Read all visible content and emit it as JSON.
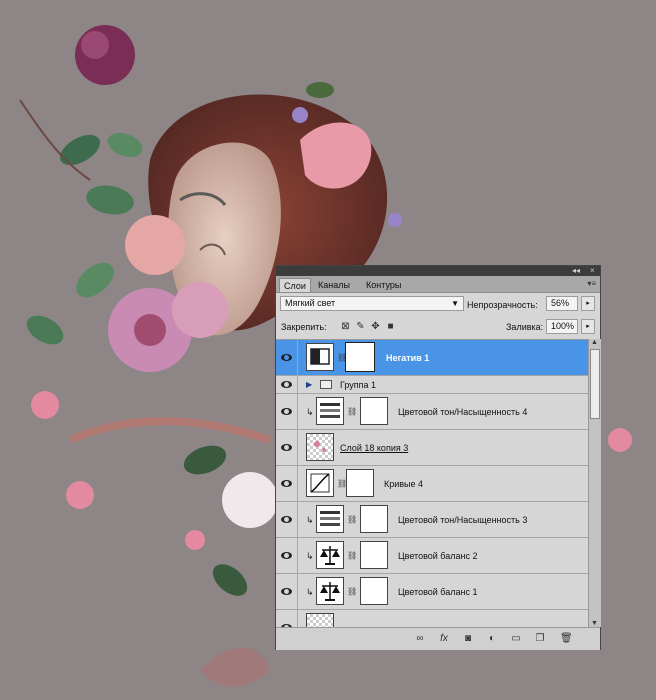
{
  "panel": {
    "topbar": {
      "collapse_glyph": "◂◂",
      "close_glyph": "×"
    },
    "tabs": [
      {
        "label": "Слои",
        "active": true
      },
      {
        "label": "Каналы",
        "active": false
      },
      {
        "label": "Контуры",
        "active": false
      }
    ],
    "menu_icon": "panel-menu-icon",
    "blend_mode": "Мягкий свет",
    "opacity_label": "Непрозрачность:",
    "opacity_value": "56%",
    "lock_label": "Закрепить:",
    "fill_label": "Заливка:",
    "fill_value": "100%",
    "layers": [
      {
        "name": "Негатив 1",
        "kind": "adjustment",
        "icon": "invert-icon",
        "selected": true,
        "clipped": false,
        "mask": true
      },
      {
        "name": "Группа 1",
        "kind": "group",
        "selected": false
      },
      {
        "name": "Цветовой тон/Насыщенность 4",
        "kind": "adjustment",
        "icon": "hue-saturation-icon",
        "clipped": true,
        "mask": true
      },
      {
        "name": "Слой 18 копия 3",
        "kind": "pixel",
        "icon": "pixel-thumb",
        "clipped": false,
        "mask": false
      },
      {
        "name": "Кривые 4",
        "kind": "adjustment",
        "icon": "curves-icon",
        "clipped": false,
        "mask": true
      },
      {
        "name": "Цветовой тон/Насыщенность 3",
        "kind": "adjustment",
        "icon": "hue-saturation-icon",
        "clipped": true,
        "mask": true
      },
      {
        "name": "Цветовой баланс 2",
        "kind": "adjustment",
        "icon": "color-balance-icon",
        "clipped": true,
        "mask": true
      },
      {
        "name": "Цветовой баланс 1",
        "kind": "adjustment",
        "icon": "color-balance-icon",
        "clipped": true,
        "mask": true
      }
    ],
    "bottom_icons": [
      "link-icon",
      "fx-icon",
      "mask-icon",
      "adjustment-icon",
      "group-folder-icon",
      "new-layer-icon",
      "trash-icon"
    ]
  },
  "colors": {
    "canvas_background": "#8e8587",
    "selection": "#4a94e8",
    "annotation_arrow": "#e8201c"
  }
}
